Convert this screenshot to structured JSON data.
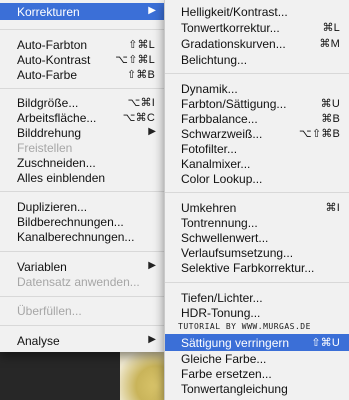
{
  "left_menu": {
    "items": [
      {
        "label": "Korrekturen",
        "shortcut": "",
        "submenu": true,
        "selected": true
      },
      {
        "label": "Auto-Farbton",
        "shortcut": "⇧⌘L"
      },
      {
        "label": "Auto-Kontrast",
        "shortcut": "⌥⇧⌘L"
      },
      {
        "label": "Auto-Farbe",
        "shortcut": "⇧⌘B"
      },
      {
        "label": "Bildgröße...",
        "shortcut": "⌥⌘I"
      },
      {
        "label": "Arbeitsfläche...",
        "shortcut": "⌥⌘C"
      },
      {
        "label": "Bilddrehung",
        "shortcut": "",
        "submenu": true
      },
      {
        "label": "Freistellen",
        "shortcut": "",
        "disabled": true
      },
      {
        "label": "Zuschneiden...",
        "shortcut": ""
      },
      {
        "label": "Alles einblenden",
        "shortcut": ""
      },
      {
        "label": "Duplizieren...",
        "shortcut": ""
      },
      {
        "label": "Bildberechnungen...",
        "shortcut": ""
      },
      {
        "label": "Kanalberechnungen...",
        "shortcut": ""
      },
      {
        "label": "Variablen",
        "shortcut": "",
        "submenu": true
      },
      {
        "label": "Datensatz anwenden...",
        "shortcut": "",
        "disabled": true
      },
      {
        "label": "Überfüllen...",
        "shortcut": "",
        "disabled": true
      },
      {
        "label": "Analyse",
        "shortcut": "",
        "submenu": true
      }
    ]
  },
  "right_menu": {
    "items": [
      {
        "label": "Helligkeit/Kontrast...",
        "shortcut": ""
      },
      {
        "label": "Tonwertkorrektur...",
        "shortcut": "⌘L"
      },
      {
        "label": "Gradationskurven...",
        "shortcut": "⌘M"
      },
      {
        "label": "Belichtung...",
        "shortcut": ""
      },
      {
        "label": "Dynamik...",
        "shortcut": ""
      },
      {
        "label": "Farbton/Sättigung...",
        "shortcut": "⌘U"
      },
      {
        "label": "Farbbalance...",
        "shortcut": "⌘B"
      },
      {
        "label": "Schwarzweiß...",
        "shortcut": "⌥⇧⌘B"
      },
      {
        "label": "Fotofilter...",
        "shortcut": ""
      },
      {
        "label": "Kanalmixer...",
        "shortcut": ""
      },
      {
        "label": "Color Lookup...",
        "shortcut": ""
      },
      {
        "label": "Umkehren",
        "shortcut": "⌘I"
      },
      {
        "label": "Tontrennung...",
        "shortcut": ""
      },
      {
        "label": "Schwellenwert...",
        "shortcut": ""
      },
      {
        "label": "Verlaufsumsetzung...",
        "shortcut": ""
      },
      {
        "label": "Selektive Farbkorrektur...",
        "shortcut": ""
      },
      {
        "label": "Tiefen/Lichter...",
        "shortcut": ""
      },
      {
        "label": "HDR-Tonung...",
        "shortcut": ""
      },
      {
        "label": "Sättigung verringern",
        "shortcut": "⇧⌘U",
        "selected": true
      },
      {
        "label": "Gleiche Farbe...",
        "shortcut": ""
      },
      {
        "label": "Farbe ersetzen...",
        "shortcut": ""
      },
      {
        "label": "Tonwertangleichung",
        "shortcut": ""
      }
    ]
  },
  "watermark": "TUTORIAL BY WWW.MURGAS.DE",
  "colors": {
    "selection": "#3b6fd7",
    "menu_bg": "#f1f1f1",
    "disabled": "#a6a6a6"
  }
}
